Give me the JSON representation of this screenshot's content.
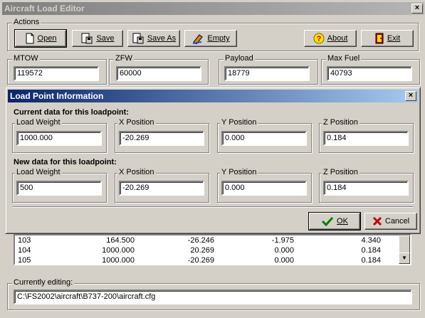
{
  "window": {
    "title": "Aircraft Load Editor",
    "close": "×"
  },
  "actions": {
    "group_label": "Actions",
    "open": "Open",
    "save": "Save",
    "save_as": "Save As",
    "empty": "Empty",
    "about": "About",
    "exit": "Exit"
  },
  "weights": {
    "mtow_label": "MTOW",
    "mtow": "119572",
    "zfw_label": "ZFW",
    "zfw": "60000",
    "payload_label": "Payload",
    "payload": "18779",
    "maxfuel_label": "Max Fuel",
    "maxfuel": "40793"
  },
  "dialog": {
    "title": "Load Point Information",
    "close": "×",
    "current_heading": "Current data for this loadpoint:",
    "new_heading": "New data for this loadpoint:",
    "load_weight_label": "Load Weight",
    "x_label": "X Position",
    "y_label": "Y Position",
    "z_label": "Z Position",
    "current": {
      "load_weight": "1000.000",
      "x": "-20.269",
      "y": "0.000",
      "z": "0.184"
    },
    "new": {
      "load_weight": "500",
      "x": "-20.269",
      "y": "0.000",
      "z": "0.184"
    },
    "ok": "OK",
    "cancel": "Cancel"
  },
  "loadpoints": {
    "rows": [
      {
        "id": "103",
        "weight": "164.500",
        "x": "-26.246",
        "y": "-1.975",
        "z": "4.340"
      },
      {
        "id": "104",
        "weight": "1000.000",
        "x": "20.269",
        "y": "0.000",
        "z": "0.184"
      },
      {
        "id": "105",
        "weight": "1000.000",
        "x": "-20.269",
        "y": "0.000",
        "z": "0.184"
      }
    ]
  },
  "editing": {
    "label": "Currently editing:",
    "path": "C:\\FS2002\\aircraft\\B737-200\\aircraft.cfg"
  }
}
